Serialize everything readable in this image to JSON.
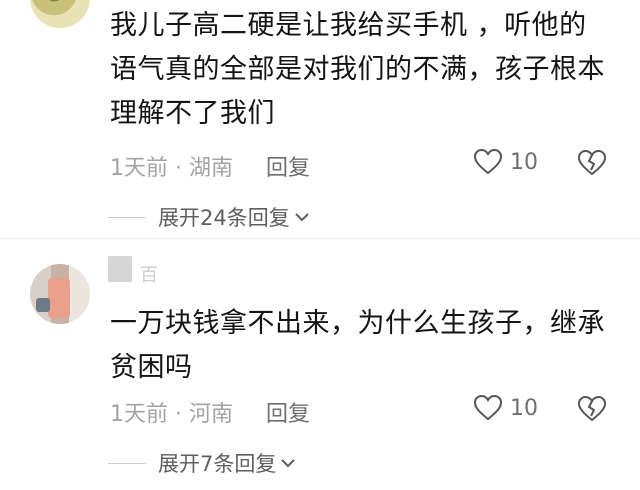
{
  "comments": [
    {
      "text": "我儿子高二硬是让我给买手机 ，听他的语气真的全部是对我们的不满，孩子根本理解不了我们",
      "time_location": "1天前 · 湖南",
      "reply_label": "回复",
      "like_count": "10",
      "expand_label": "展开24条回复"
    },
    {
      "username": "百",
      "text": "一万块钱拿不出来，为什么生孩子，继承贫困吗",
      "time_location": "1天前 · 河南",
      "reply_label": "回复",
      "like_count": "10",
      "expand_label": "展开7条回复"
    }
  ],
  "icons": {
    "like": "heart-outline-icon",
    "dislike": "broken-heart-icon",
    "expand": "chevron-down-icon"
  }
}
